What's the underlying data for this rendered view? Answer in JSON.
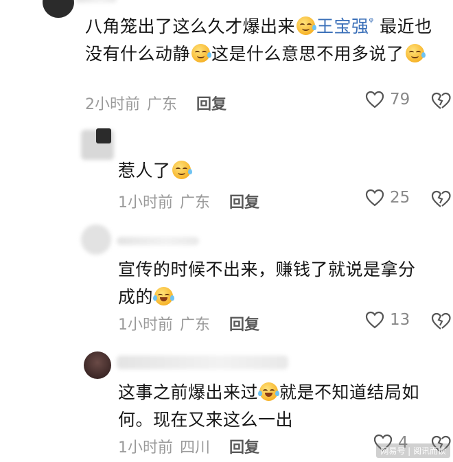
{
  "comments": [
    {
      "text_before_emoji": "八角笼出了这么久才爆出来",
      "mention": "王宝强",
      "text_line2": "最近也没有什么动静",
      "text_after_emoji": "这是什么意思不用多说了",
      "time": "2小时前",
      "region": "广东",
      "reply_label": "回复",
      "likes": "79"
    },
    {
      "text": "惹人了",
      "time": "1小时前",
      "region": "广东",
      "reply_label": "回复",
      "likes": "25"
    },
    {
      "text": "宣传的时候不出来，赚钱了就说是拿分成的",
      "time": "1小时前",
      "region": "广东",
      "reply_label": "回复",
      "likes": "13"
    },
    {
      "text_before_emoji": "这事之前爆出来过",
      "text_after_emoji": "就是不知道结局如何。现在又来这么一出",
      "time": "1小时前",
      "region": "四川",
      "reply_label": "回复",
      "likes": "4"
    }
  ],
  "watermark": "网易号 | 阅讯而读",
  "icons": {
    "like": "heart-outline-icon",
    "dislike": "heart-broken-outline-icon",
    "emoji_smirk": "sweat-smile-emoji",
    "emoji_laugh": "tears-of-joy-emoji"
  }
}
